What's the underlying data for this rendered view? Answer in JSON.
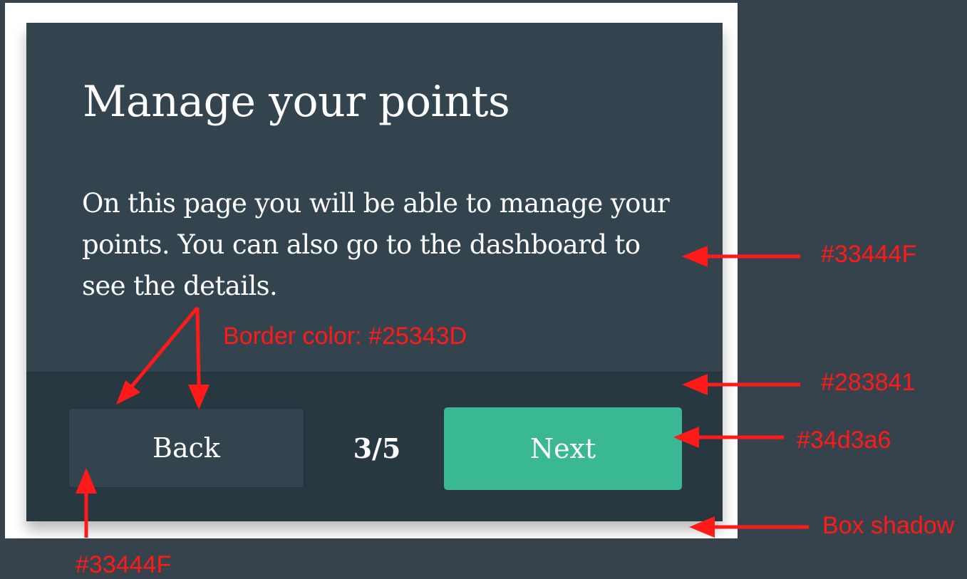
{
  "card": {
    "title": "Manage your points",
    "body": "On this page you will be able to manage your points. You can also go to the dashboard to see the details.",
    "back_label": "Back",
    "step": "3/5",
    "next_label": "Next"
  },
  "annotations": {
    "card_bg": "#33444F",
    "border_color": "Border color: #25343D",
    "footer_bg": "#283841",
    "next_bg": "#34d3a6",
    "box_shadow": "Box shadow",
    "back_bg": "#33444F"
  },
  "colors": {
    "card_bg": "#33444F",
    "footer_bg": "#283841",
    "border": "#25343D",
    "accent": "#34d3a6",
    "annotation": "#ff1a1a"
  }
}
